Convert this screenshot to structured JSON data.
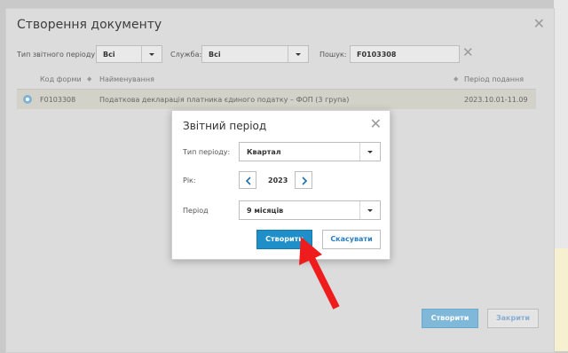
{
  "main_dialog": {
    "title": "Створення документу",
    "filters": {
      "period_type_label": "Тип звітного періоду:",
      "period_type_value": "Всі",
      "service_label": "Служба:",
      "service_value": "Всі",
      "search_label": "Пошук:",
      "search_value": "F0103308"
    },
    "table": {
      "columns": [
        "Код форми",
        "Найменування",
        "Період подання"
      ],
      "rows": [
        {
          "code": "F0103308",
          "name": "Податкова декларація платника єдиного податку – ФОП (3 група)",
          "period": "2023.10.01-11.09"
        }
      ]
    },
    "buttons": {
      "create": "Створити",
      "close": "Закрити"
    }
  },
  "modal": {
    "title": "Звітний період",
    "period_type_label": "Тип періоду:",
    "period_type_value": "Квартал",
    "year_label": "Рік:",
    "year_value": "2023",
    "period_label": "Період",
    "period_value": "9 місяців",
    "buttons": {
      "create": "Створити",
      "cancel": "Скасувати"
    }
  },
  "colors": {
    "primary": "#1f8fc9",
    "arrow": "#ee1c1c"
  }
}
